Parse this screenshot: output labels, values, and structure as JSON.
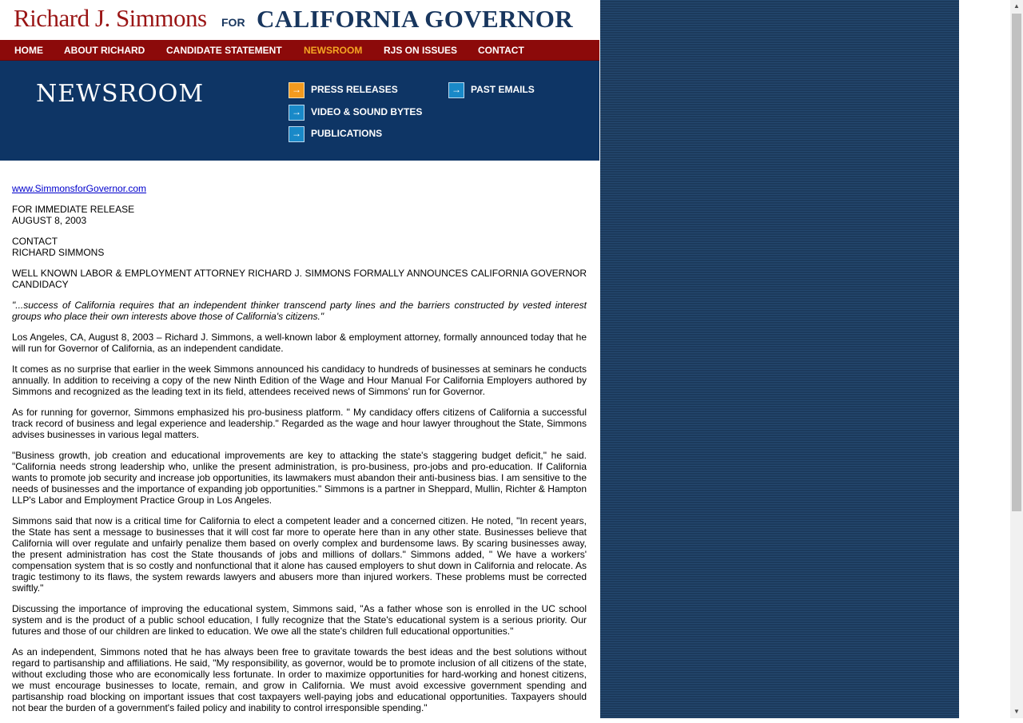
{
  "header": {
    "name": "Richard J. Simmons",
    "for": "FOR",
    "office": "CALIFORNIA GOVERNOR"
  },
  "nav": {
    "items": [
      {
        "label": "HOME"
      },
      {
        "label": "ABOUT RICHARD"
      },
      {
        "label": "CANDIDATE STATEMENT"
      },
      {
        "label": "NEWSROOM",
        "active": true
      },
      {
        "label": "RJS ON ISSUES"
      },
      {
        "label": "CONTACT"
      }
    ]
  },
  "banner": {
    "title": "NEWSROOM",
    "links": [
      {
        "label": "PRESS RELEASES",
        "icon": "arrow-right-icon",
        "active": true
      },
      {
        "label": "VIDEO & SOUND BYTES",
        "icon": "arrow-right-icon"
      },
      {
        "label": "PUBLICATIONS",
        "icon": "arrow-right-icon"
      },
      {
        "label": "PAST EMAILS",
        "icon": "arrow-right-icon"
      }
    ]
  },
  "release": {
    "site_link": "www.SimmonsforGovernor.com",
    "release_line1": "FOR IMMEDIATE RELEASE",
    "release_line2": "AUGUST 8, 2003",
    "contact_line1": "CONTACT",
    "contact_line2": "RICHARD SIMMONS",
    "headline": "WELL KNOWN LABOR & EMPLOYMENT ATTORNEY RICHARD J. SIMMONS FORMALLY ANNOUNCES CALIFORNIA GOVERNOR CANDIDACY",
    "quote": "\"...success of California requires that an independent thinker transcend party lines and the barriers constructed by vested interest groups who place their own interests above those of California's citizens.\"",
    "paragraphs": [
      "Los Angeles, CA, August 8, 2003 – Richard J. Simmons, a well-known labor & employment attorney, formally announced today that he will run for Governor of California, as an independent candidate.",
      "It comes as no surprise that earlier in the week Simmons announced his candidacy to hundreds of businesses at seminars he conducts annually. In addition to receiving a copy of the new Ninth Edition of the Wage and Hour Manual For California Employers authored by Simmons and recognized as the leading text in its field, attendees received news of Simmons' run for Governor.",
      "As for running for governor, Simmons emphasized his pro-business platform. \" My candidacy offers citizens of California a successful track record of business and legal experience and leadership.\" Regarded as the wage and hour lawyer throughout the State, Simmons advises businesses in various legal matters.",
      "\"Business growth, job creation and educational improvements are key to attacking the state's staggering budget deficit,\" he said. \"California needs strong leadership who, unlike the present administration, is pro-business, pro-jobs and pro-education. If California wants to promote job security and increase job opportunities, its lawmakers must abandon their anti-business bias. I am sensitive to the needs of businesses and the importance of expanding job opportunities.\" Simmons is a partner in Sheppard, Mullin, Richter & Hampton LLP's Labor and Employment Practice Group in Los Angeles.",
      "Simmons said that now is a critical time for California to elect a competent leader and a concerned citizen. He noted, \"In recent years, the State has sent a message to businesses that it will cost far more to operate here than in any other state. Businesses believe that California will over regulate and unfairly penalize them based on overly complex and burdensome laws. By scaring businesses away, the present administration has cost the State thousands of jobs and millions of dollars.\" Simmons added, \" We have a workers' compensation system that is so costly and nonfunctional that it alone has caused employers to shut down in California and relocate. As tragic testimony to its flaws, the system rewards lawyers and abusers more than injured workers. These problems must be corrected swiftly.\"",
      "Discussing the importance of improving the educational system, Simmons said, \"As a father whose son is enrolled in the UC school system and is the product of a public school education, I fully recognize that the State's educational system is a serious priority. Our futures and those of our children are linked to education. We owe all the state's children full educational opportunities.\"",
      "As an independent, Simmons noted that he has always been free to gravitate towards the best ideas and the best solutions without regard to partisanship and affiliations. He said, \"My responsibility, as governor, would be to promote inclusion of all citizens of the state, without excluding those who are economically less fortunate. In order to maximize opportunities for hard-working and honest citizens, we must encourage businesses to locate, remain, and grow in California. We must avoid excessive government spending and partisanship road blocking on important issues that cost taxpayers well-paying jobs and educational opportunities. Taxpayers should not bear the burden of a government's failed policy and inability to control irresponsible spending.\""
    ]
  },
  "colors": {
    "brand_red": "#8c0a0a",
    "brand_navy": "#0e3565",
    "nav_active": "#f5a623",
    "link_blue": "#0000cc"
  }
}
